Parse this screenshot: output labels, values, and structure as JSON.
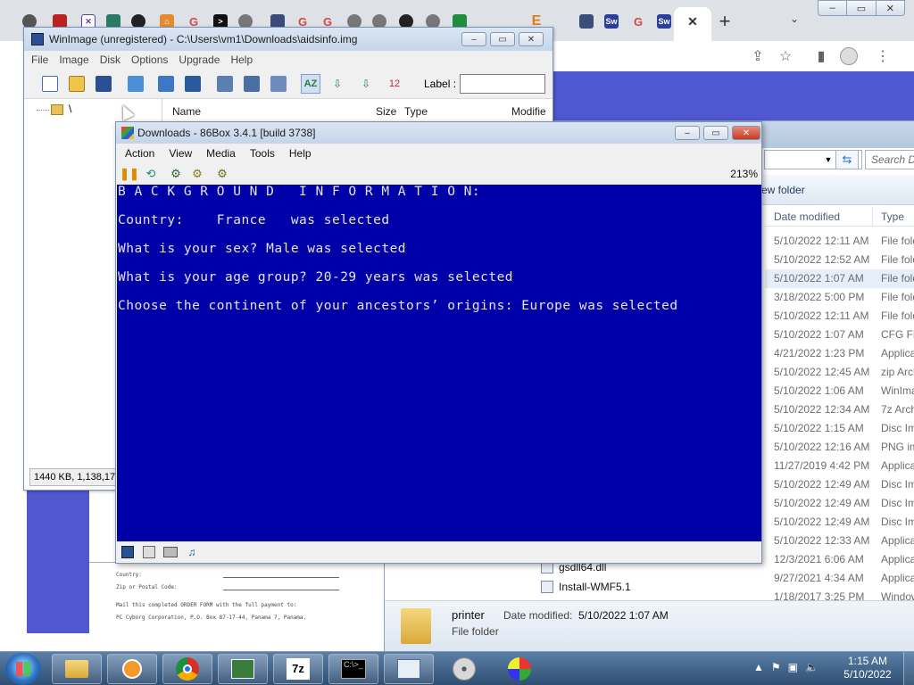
{
  "chrome": {
    "tab_icons": [
      "opera-icon",
      "red-square-icon",
      "vs-icon",
      "green-icon",
      "github-icon",
      "home-icon",
      "google-icon",
      "terminal-icon",
      "globe-icon",
      "bitwarden-icon",
      "google-icon",
      "google-icon",
      "globe-icon",
      "globe-icon",
      "github-icon",
      "globe-icon",
      "sheets-icon",
      "E-icon",
      "save-icon",
      "sw-icon",
      "google-icon",
      "sw-icon"
    ],
    "new_tab_label": "+",
    "tab_menu_label": "⌄",
    "controls": {
      "min": "–",
      "max": "▭",
      "close": "✕"
    }
  },
  "winimage": {
    "title": "WinImage (unregistered) - C:\\Users\\vm1\\Downloads\\aidsinfo.img",
    "menu": [
      "File",
      "Image",
      "Disk",
      "Options",
      "Upgrade",
      "Help"
    ],
    "label_text": "Label :",
    "label_value": "",
    "tree_root": "\\",
    "columns": {
      "name": "Name",
      "size": "Size",
      "type": "Type",
      "modified": "Modifie"
    },
    "status": "1440 KB, 1,138,17"
  },
  "box86": {
    "title": "Downloads - 86Box 3.4.1 [build 3738]",
    "menu": [
      "Action",
      "View",
      "Media",
      "Tools",
      "Help"
    ],
    "zoom": "213%",
    "screen_lines": [
      "B A C K G R O U N D   I N F O R M A T I O N:",
      "Country:    France   was selected",
      "What is your sex? Male was selected",
      "What is your age group? 20-29 years was selected",
      "Choose the continent of your ancestors’ origins: Europe was selected"
    ],
    "colors": {
      "screen_bg": "#0000a8",
      "screen_fg": "#e4e4e4"
    }
  },
  "explorer": {
    "search_placeholder": "Search D",
    "new_folder": "ew folder",
    "col_date": "Date modified",
    "col_type": "Type",
    "rows": [
      {
        "date": "5/10/2022 12:11 AM",
        "type": "File fold"
      },
      {
        "date": "5/10/2022 12:52 AM",
        "type": "File fold"
      },
      {
        "date": "5/10/2022 1:07 AM",
        "type": "File fold"
      },
      {
        "date": "3/18/2022 5:00 PM",
        "type": "File fold"
      },
      {
        "date": "5/10/2022 12:11 AM",
        "type": "File fold"
      },
      {
        "date": "5/10/2022 1:07 AM",
        "type": "CFG File"
      },
      {
        "date": "4/21/2022 1:23 PM",
        "type": "Applicat"
      },
      {
        "date": "5/10/2022 12:45 AM",
        "type": "zip Archi"
      },
      {
        "date": "5/10/2022 1:06 AM",
        "type": "WinIma"
      },
      {
        "date": "5/10/2022 12:34 AM",
        "type": "7z Archi"
      },
      {
        "date": "5/10/2022 1:15 AM",
        "type": "Disc Ima"
      },
      {
        "date": "5/10/2022 12:16 AM",
        "type": "PNG ima"
      },
      {
        "date": "11/27/2019 4:42 PM",
        "type": "Applicat"
      },
      {
        "date": "5/10/2022 12:49 AM",
        "type": "Disc Ima"
      },
      {
        "date": "5/10/2022 12:49 AM",
        "type": "Disc Ima"
      },
      {
        "date": "5/10/2022 12:49 AM",
        "type": "Disc Ima"
      },
      {
        "date": "5/10/2022 12:33 AM",
        "type": "Applicat"
      },
      {
        "date": "12/3/2021 6:06 AM",
        "type": "Applicat"
      },
      {
        "date": "9/27/2021 4:34 AM",
        "type": "Applicat"
      },
      {
        "date": "1/18/2017 3:25 PM",
        "type": "Window"
      }
    ],
    "lower_items": [
      {
        "name": "gsdll64.dll"
      },
      {
        "name": "Install-WMF5.1"
      }
    ],
    "details": {
      "name": "printer",
      "type": "File folder",
      "date_label": "Date modified:",
      "date_value": "5/10/2022 1:07 AM"
    }
  },
  "scan": {
    "lines": [
      "Country:",
      "Zip or Postal Code:",
      "Mail this completed ORDER FORM with the full payment to:",
      "PC Cyborg Corporation, P.O. Box 87-17-44, Panama 7, Panama."
    ]
  },
  "taskbar": {
    "buttons": [
      "explorer-icon",
      "media-player-icon",
      "chrome-icon",
      "86box-icon",
      "7zip-icon",
      "cmd-icon",
      "winimage-icon",
      "disc-icon",
      "paint-icon"
    ],
    "time": "1:15 AM",
    "date": "5/10/2022"
  }
}
